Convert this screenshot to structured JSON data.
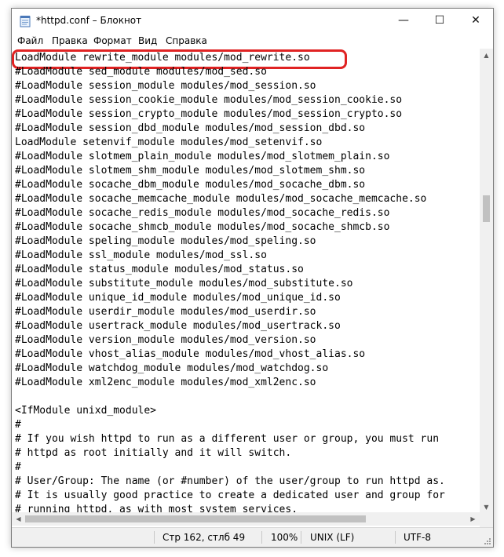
{
  "window": {
    "title": "*httpd.conf – Блокнот",
    "controls": {
      "minimize": "—",
      "maximize": "☐",
      "close": "✕"
    }
  },
  "menu": [
    "Файл",
    "Правка",
    "Формат",
    "Вид",
    "Справка"
  ],
  "editor": {
    "lines": [
      "LoadModule rewrite_module modules/mod_rewrite.so",
      "#LoadModule sed_module modules/mod_sed.so",
      "#LoadModule session_module modules/mod_session.so",
      "#LoadModule session_cookie_module modules/mod_session_cookie.so",
      "#LoadModule session_crypto_module modules/mod_session_crypto.so",
      "#LoadModule session_dbd_module modules/mod_session_dbd.so",
      "LoadModule setenvif_module modules/mod_setenvif.so",
      "#LoadModule slotmem_plain_module modules/mod_slotmem_plain.so",
      "#LoadModule slotmem_shm_module modules/mod_slotmem_shm.so",
      "#LoadModule socache_dbm_module modules/mod_socache_dbm.so",
      "#LoadModule socache_memcache_module modules/mod_socache_memcache.so",
      "#LoadModule socache_redis_module modules/mod_socache_redis.so",
      "#LoadModule socache_shmcb_module modules/mod_socache_shmcb.so",
      "#LoadModule speling_module modules/mod_speling.so",
      "#LoadModule ssl_module modules/mod_ssl.so",
      "#LoadModule status_module modules/mod_status.so",
      "#LoadModule substitute_module modules/mod_substitute.so",
      "#LoadModule unique_id_module modules/mod_unique_id.so",
      "#LoadModule userdir_module modules/mod_userdir.so",
      "#LoadModule usertrack_module modules/mod_usertrack.so",
      "#LoadModule version_module modules/mod_version.so",
      "#LoadModule vhost_alias_module modules/mod_vhost_alias.so",
      "#LoadModule watchdog_module modules/mod_watchdog.so",
      "#LoadModule xml2enc_module modules/mod_xml2enc.so",
      "",
      "<IfModule unixd_module>",
      "#",
      "# If you wish httpd to run as a different user or group, you must run",
      "# httpd as root initially and it will switch.",
      "#",
      "# User/Group: The name (or #number) of the user/group to run httpd as.",
      "# It is usually good practice to create a dedicated user and group for",
      "# running httpd, as with most system services."
    ]
  },
  "status": {
    "position": "Стр 162, стлб 49",
    "zoom": "100%",
    "line_endings": "UNIX (LF)",
    "encoding": "UTF-8"
  },
  "colors": {
    "highlight": "#e02323",
    "statusbar_bg": "#f0f0f0"
  }
}
